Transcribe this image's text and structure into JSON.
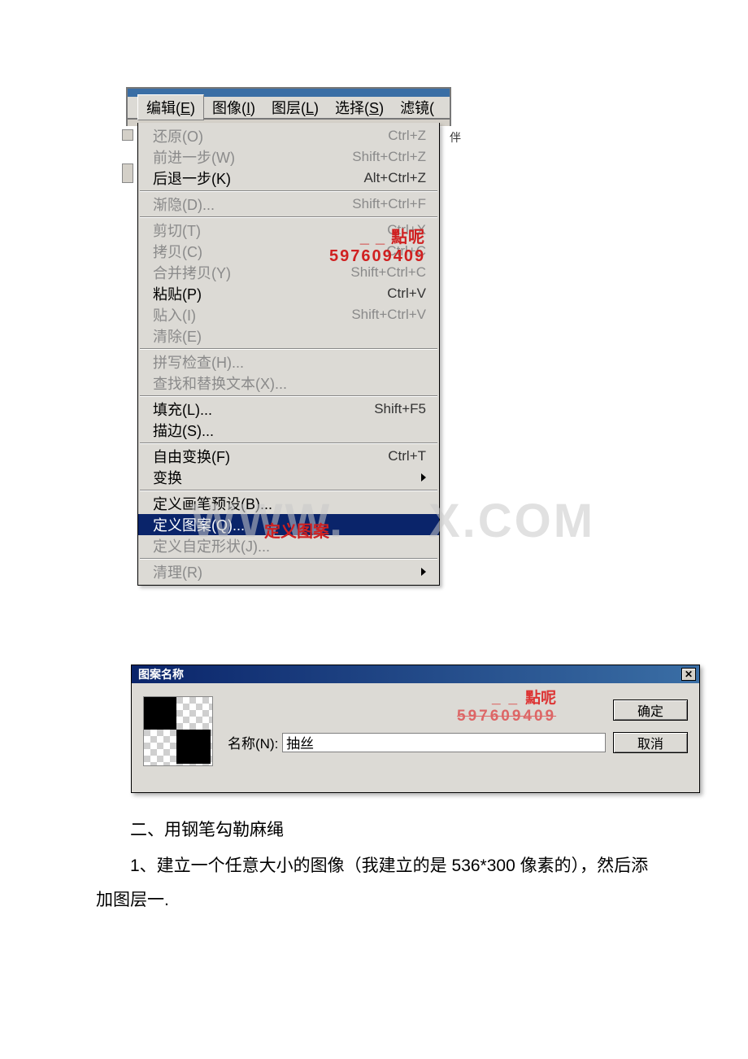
{
  "menubar": {
    "items": [
      {
        "label_pre": "编辑(",
        "key": "E",
        "label_post": ")"
      },
      {
        "label_pre": "图像(",
        "key": "I",
        "label_post": ")"
      },
      {
        "label_pre": "图层(",
        "key": "L",
        "label_post": ")"
      },
      {
        "label_pre": "选择(",
        "key": "S",
        "label_post": ")"
      },
      {
        "label_pre": "滤镜(",
        "key": "",
        "label_post": ""
      }
    ]
  },
  "edit_menu": {
    "groups": [
      [
        {
          "label": "还原(O)",
          "shortcut": "Ctrl+Z",
          "disabled": true
        },
        {
          "label": "前进一步(W)",
          "shortcut": "Shift+Ctrl+Z",
          "disabled": true
        },
        {
          "label": "后退一步(K)",
          "shortcut": "Alt+Ctrl+Z",
          "disabled": false
        }
      ],
      [
        {
          "label": "渐隐(D)...",
          "shortcut": "Shift+Ctrl+F",
          "disabled": true
        }
      ],
      [
        {
          "label": "剪切(T)",
          "shortcut": "Ctrl+X",
          "disabled": true
        },
        {
          "label": "拷贝(C)",
          "shortcut": "Ctrl+C",
          "disabled": true
        },
        {
          "label": "合并拷贝(Y)",
          "shortcut": "Shift+Ctrl+C",
          "disabled": true
        },
        {
          "label": "粘贴(P)",
          "shortcut": "Ctrl+V",
          "disabled": false
        },
        {
          "label": "贴入(I)",
          "shortcut": "Shift+Ctrl+V",
          "disabled": true
        },
        {
          "label": "清除(E)",
          "shortcut": "",
          "disabled": true
        }
      ],
      [
        {
          "label": "拼写检查(H)...",
          "shortcut": "",
          "disabled": true
        },
        {
          "label": "查找和替换文本(X)...",
          "shortcut": "",
          "disabled": true
        }
      ],
      [
        {
          "label": "填充(L)...",
          "shortcut": "Shift+F5",
          "disabled": false
        },
        {
          "label": "描边(S)...",
          "shortcut": "",
          "disabled": false
        }
      ],
      [
        {
          "label": "自由变换(F)",
          "shortcut": "Ctrl+T",
          "disabled": false
        },
        {
          "label": "变换",
          "shortcut": "",
          "disabled": false,
          "submenu": true
        }
      ],
      [
        {
          "label": "定义画笔预设(B)...",
          "shortcut": "",
          "disabled": false
        },
        {
          "label": "定义图案(Q)...",
          "shortcut": "",
          "disabled": false,
          "highlight": true
        },
        {
          "label": "定义自定形状(J)...",
          "shortcut": "",
          "disabled": true
        }
      ],
      [
        {
          "label": "清理(R)",
          "shortcut": "",
          "disabled": true,
          "submenu": true
        }
      ]
    ]
  },
  "annotations": {
    "menu_wm_line1": "點呢",
    "menu_wm_line2": "597609409",
    "red_label": "定义图案",
    "big_wm_left": "WWW.",
    "big_wm_right": "X.COM",
    "right_fragment": "伴"
  },
  "dialog": {
    "title": "图案名称",
    "name_label": "名称(N):",
    "name_value": "抽丝",
    "ok": "确定",
    "cancel": "取消",
    "close_icon": "✕",
    "wm_line1": "點呢",
    "wm_line2": "597609409"
  },
  "body": {
    "p1": "二、用钢笔勾勒麻绳",
    "p2": "1、建立一个任意大小的图像（我建立的是 536*300 像素的），然后添加图层一."
  }
}
